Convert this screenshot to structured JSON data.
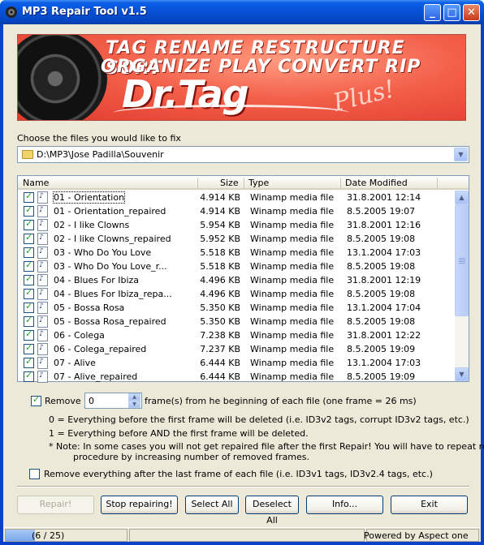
{
  "window": {
    "title": "MP3 Repair Tool v1.5",
    "minimize": "_",
    "maximize": "□",
    "close": "✕"
  },
  "banner": {
    "line1": "TAG RENAME RESTRUCTURE SORT",
    "line2": "ORGANIZE PLAY CONVERT RIP",
    "logo": "Dr.Tag",
    "plus": "Plus!"
  },
  "files_label": "Choose the files you would like to fix",
  "folder_path": "D:\\MP3\\Jose Padilla\\Souvenir",
  "columns": {
    "name": "Name",
    "size": "Size",
    "type": "Type",
    "date": "Date Modified"
  },
  "files": [
    {
      "name": "01 - Orientation",
      "size": "4.914 KB",
      "type": "Winamp media file",
      "date": "31.8.2001 12:14",
      "checked": true
    },
    {
      "name": "01 - Orientation_repaired",
      "size": "4.914 KB",
      "type": "Winamp media file",
      "date": "8.5.2005 19:07",
      "checked": true
    },
    {
      "name": "02 - I like Clowns",
      "size": "5.954 KB",
      "type": "Winamp media file",
      "date": "31.8.2001 12:16",
      "checked": true
    },
    {
      "name": "02 - I like Clowns_repaired",
      "size": "5.952 KB",
      "type": "Winamp media file",
      "date": "8.5.2005 19:08",
      "checked": true
    },
    {
      "name": "03 - Who Do You Love",
      "size": "5.518 KB",
      "type": "Winamp media file",
      "date": "13.1.2004 17:03",
      "checked": true
    },
    {
      "name": "03 - Who Do You Love_r...",
      "size": "5.518 KB",
      "type": "Winamp media file",
      "date": "8.5.2005 19:08",
      "checked": true
    },
    {
      "name": "04 - Blues For Ibiza",
      "size": "4.496 KB",
      "type": "Winamp media file",
      "date": "31.8.2001 12:19",
      "checked": true
    },
    {
      "name": "04 - Blues For Ibiza_repa...",
      "size": "4.496 KB",
      "type": "Winamp media file",
      "date": "8.5.2005 19:08",
      "checked": true
    },
    {
      "name": "05 - Bossa Rosa",
      "size": "5.350 KB",
      "type": "Winamp media file",
      "date": "13.1.2004 17:04",
      "checked": true
    },
    {
      "name": "05 - Bossa Rosa_repaired",
      "size": "5.350 KB",
      "type": "Winamp media file",
      "date": "8.5.2005 19:08",
      "checked": true
    },
    {
      "name": "06 - Colega",
      "size": "7.238 KB",
      "type": "Winamp media file",
      "date": "31.8.2001 12:22",
      "checked": true
    },
    {
      "name": "06 - Colega_repaired",
      "size": "7.237 KB",
      "type": "Winamp media file",
      "date": "8.5.2005 19:09",
      "checked": true
    },
    {
      "name": "07 - Alive",
      "size": "6.444 KB",
      "type": "Winamp media file",
      "date": "13.1.2004 17:03",
      "checked": true
    },
    {
      "name": "07 - Alive_repaired",
      "size": "6.444 KB",
      "type": "Winamp media file",
      "date": "8.5.2005 19:09",
      "checked": true
    }
  ],
  "remove": {
    "checked": true,
    "label": "Remove",
    "value": "0",
    "suffix": "frame(s) from he beginning of each file (one frame = 26 ms)"
  },
  "notes": {
    "n0": "0 = Everything before the first frame will be deleted (i.e. ID3v2 tags, corrupt ID3v2 tags, etc.)",
    "n1": "1 = Everything before AND the first frame will be deleted.",
    "n2a": "* Note:  In some cases you will not get repaired file after the first Repair! You will have to repeat repair",
    "n2b": "procedure by increasing number of removed frames."
  },
  "remove_after": {
    "checked": false,
    "label": "Remove everything after the last frame of each file (i.e. ID3v1 tags, ID3v2.4 tags, etc.)"
  },
  "buttons": {
    "repair": "Repair!",
    "stop": "Stop repairing!",
    "select_all": "Select All",
    "deselect_all": "Deselect All",
    "info": "Info...",
    "exit": "Exit"
  },
  "status": {
    "progress_text": "(6 / 25)",
    "progress_fraction": 0.24,
    "powered": "Powered by Aspect one"
  }
}
